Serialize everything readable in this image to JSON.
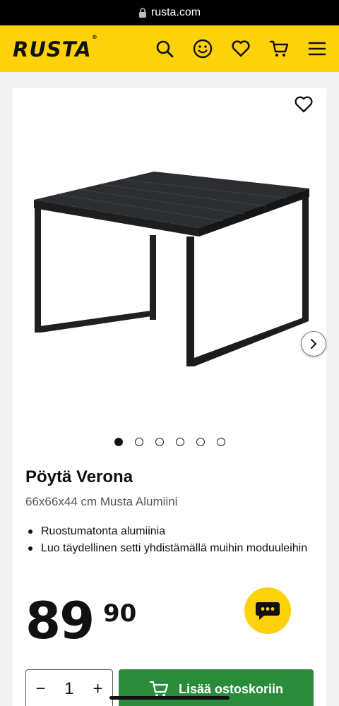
{
  "browser": {
    "url": "rusta.com"
  },
  "header": {
    "logo": "RUSTA",
    "logo_mark": "®"
  },
  "product": {
    "title": "Pöytä Verona",
    "subtitle": "66x66x44 cm Musta Alumiini",
    "features": [
      "Ruostumatonta alumiinia",
      "Luo täydellinen setti yhdistämällä muihin moduuleihin"
    ],
    "price_main": "89",
    "price_decimals": "90",
    "image_count": 6,
    "active_image": 1
  },
  "cart": {
    "quantity": "1",
    "minus": "−",
    "plus": "+",
    "add_label": "Lisää ostoskoriin"
  },
  "colors": {
    "brand": "#fdd20b",
    "add_button": "#2a8c3a"
  }
}
